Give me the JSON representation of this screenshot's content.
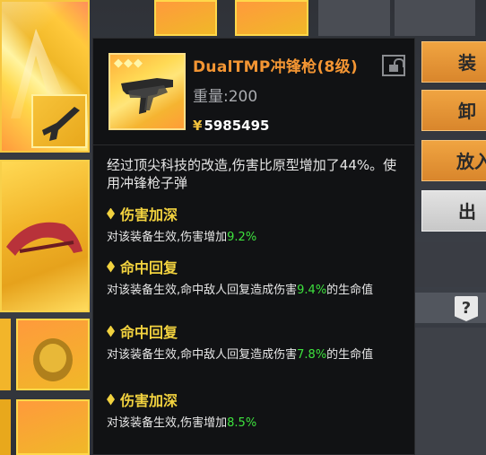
{
  "item": {
    "name": "DualTMP冲锋枪(8级)",
    "stars": "◆◆◆",
    "weight": "重量:200",
    "price_symbol": "¥",
    "price": "5985495",
    "description": "经过顶尖科技的改造,伤害比原型增加了44%。使用冲锋枪子弹"
  },
  "affixes": [
    {
      "title": "伤害加深",
      "text_before": "对该装备生效,伤害增加",
      "value": "9.2%",
      "text_after": ""
    },
    {
      "title": "命中回复",
      "text_before": "对该装备生效,命中敌人回复造成伤害",
      "value": "9.4%",
      "text_after": "的生命值"
    },
    {
      "title": "命中回复",
      "text_before": "对该装备生效,命中敌人回复造成伤害",
      "value": "7.8%",
      "text_after": "的生命值"
    },
    {
      "title": "伤害加深",
      "text_before": "对该装备生效,伤害增加",
      "value": "8.5%",
      "text_after": ""
    }
  ],
  "side_buttons": [
    "装",
    "卸",
    "放入",
    "出"
  ],
  "help_icon_label": "?",
  "colors": {
    "tooltip_bg": "#111214",
    "item_name": "#f39533",
    "affix_title": "#f2d23f",
    "highlight_value": "#3ee23e",
    "price": "#ffffff"
  },
  "icons": [
    "lock-icon",
    "diamond-icon",
    "smg-icon",
    "help-icon"
  ]
}
